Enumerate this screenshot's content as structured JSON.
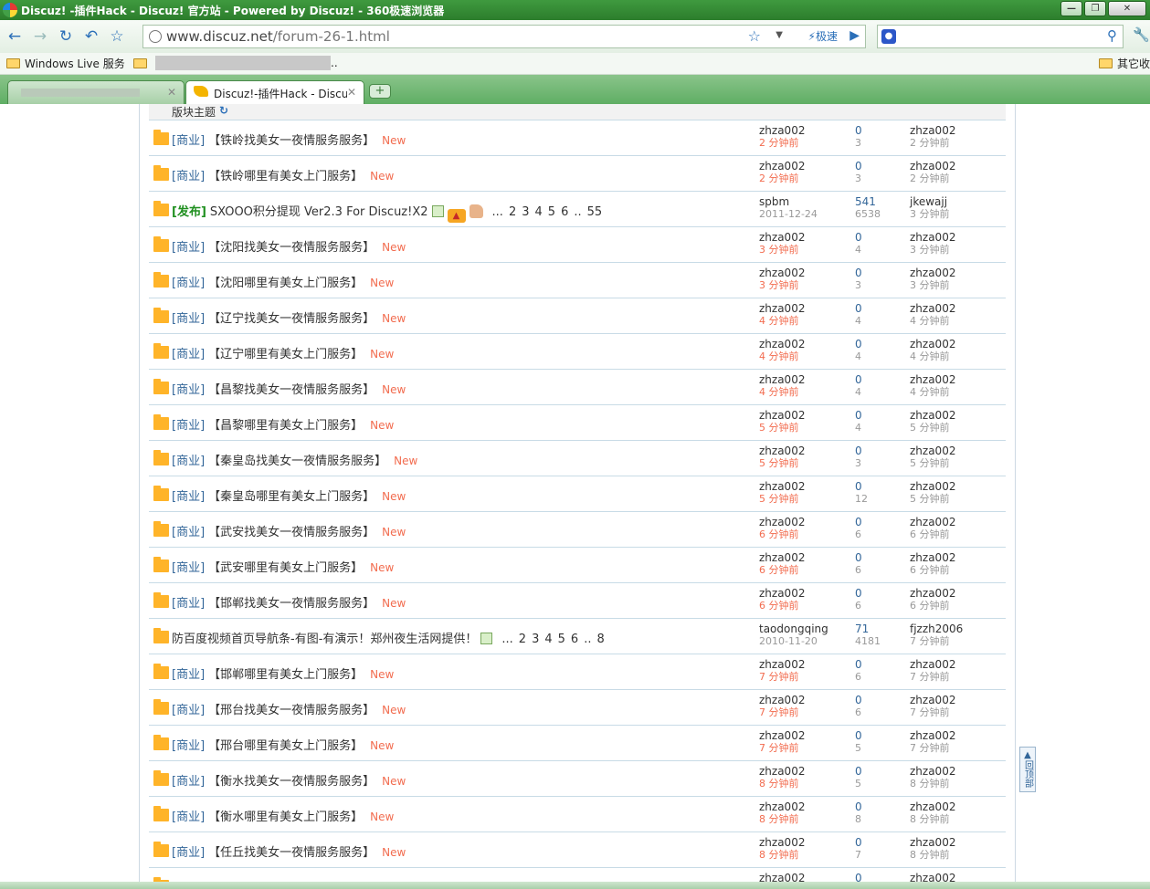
{
  "window": {
    "title": "Discuz! -插件Hack - Discuz! 官方站 - Powered by Discuz! - 360极速浏览器"
  },
  "nav": {
    "url_host": "www.discuz.net",
    "url_path": "/forum-26-1.html",
    "speed_label": "极速"
  },
  "bookmarks": {
    "item1": "Windows Live 服务",
    "item2_suffix": "..",
    "other": "其它收"
  },
  "tabs": {
    "active_title": "Discuz!-插件Hack - Discuz!"
  },
  "forum": {
    "header_label": "版块主题",
    "back_to_top": "回顶部",
    "threads": [
      {
        "cat": "[商业]",
        "title": "【铁岭找美女一夜情服务服务】",
        "new": "New",
        "author": "zhza002",
        "time": "2 分钟前",
        "replies": "0",
        "views": "3",
        "last": "zhza002",
        "last_time": "2 分钟前"
      },
      {
        "cat": "[商业]",
        "title": "【铁岭哪里有美女上门服务】",
        "new": "New",
        "author": "zhza002",
        "time": "2 分钟前",
        "replies": "0",
        "views": "3",
        "last": "zhza002",
        "last_time": "2 分钟前"
      },
      {
        "cat": "[发布]",
        "title": "SXOOO积分提现 Ver2.3 For Discuz!X2",
        "new": "",
        "pages": [
          "...",
          "2",
          "3",
          "4",
          "5",
          "6",
          "..",
          "55"
        ],
        "author": "spbm",
        "time": "2011-12-24",
        "replies": "541",
        "views": "6538",
        "last": "jkewajj",
        "last_time": "3 分钟前"
      },
      {
        "cat": "[商业]",
        "title": "【沈阳找美女一夜情服务服务】",
        "new": "New",
        "author": "zhza002",
        "time": "3 分钟前",
        "replies": "0",
        "views": "4",
        "last": "zhza002",
        "last_time": "3 分钟前"
      },
      {
        "cat": "[商业]",
        "title": "【沈阳哪里有美女上门服务】",
        "new": "New",
        "author": "zhza002",
        "time": "3 分钟前",
        "replies": "0",
        "views": "3",
        "last": "zhza002",
        "last_time": "3 分钟前"
      },
      {
        "cat": "[商业]",
        "title": "【辽宁找美女一夜情服务服务】",
        "new": "New",
        "author": "zhza002",
        "time": "4 分钟前",
        "replies": "0",
        "views": "4",
        "last": "zhza002",
        "last_time": "4 分钟前"
      },
      {
        "cat": "[商业]",
        "title": "【辽宁哪里有美女上门服务】",
        "new": "New",
        "author": "zhza002",
        "time": "4 分钟前",
        "replies": "0",
        "views": "4",
        "last": "zhza002",
        "last_time": "4 分钟前"
      },
      {
        "cat": "[商业]",
        "title": "【昌黎找美女一夜情服务服务】",
        "new": "New",
        "author": "zhza002",
        "time": "4 分钟前",
        "replies": "0",
        "views": "4",
        "last": "zhza002",
        "last_time": "4 分钟前"
      },
      {
        "cat": "[商业]",
        "title": "【昌黎哪里有美女上门服务】",
        "new": "New",
        "author": "zhza002",
        "time": "5 分钟前",
        "replies": "0",
        "views": "4",
        "last": "zhza002",
        "last_time": "5 分钟前"
      },
      {
        "cat": "[商业]",
        "title": "【秦皇岛找美女一夜情服务服务】",
        "new": "New",
        "author": "zhza002",
        "time": "5 分钟前",
        "replies": "0",
        "views": "3",
        "last": "zhza002",
        "last_time": "5 分钟前"
      },
      {
        "cat": "[商业]",
        "title": "【秦皇岛哪里有美女上门服务】",
        "new": "New",
        "author": "zhza002",
        "time": "5 分钟前",
        "replies": "0",
        "views": "12",
        "last": "zhza002",
        "last_time": "5 分钟前"
      },
      {
        "cat": "[商业]",
        "title": "【武安找美女一夜情服务服务】",
        "new": "New",
        "author": "zhza002",
        "time": "6 分钟前",
        "replies": "0",
        "views": "6",
        "last": "zhza002",
        "last_time": "6 分钟前"
      },
      {
        "cat": "[商业]",
        "title": "【武安哪里有美女上门服务】",
        "new": "New",
        "author": "zhza002",
        "time": "6 分钟前",
        "replies": "0",
        "views": "6",
        "last": "zhza002",
        "last_time": "6 分钟前"
      },
      {
        "cat": "[商业]",
        "title": "【邯郸找美女一夜情服务服务】",
        "new": "New",
        "author": "zhza002",
        "time": "6 分钟前",
        "replies": "0",
        "views": "6",
        "last": "zhza002",
        "last_time": "6 分钟前"
      },
      {
        "cat": "",
        "title": "防百度视频首页导航条-有图-有演示！郑州夜生活网提供！",
        "new": "",
        "pages": [
          "...",
          "2",
          "3",
          "4",
          "5",
          "6",
          "..",
          "8"
        ],
        "author": "taodongqing",
        "time": "2010-11-20",
        "replies": "71",
        "views": "4181",
        "last": "fjzzh2006",
        "last_time": "7 分钟前"
      },
      {
        "cat": "[商业]",
        "title": "【邯郸哪里有美女上门服务】",
        "new": "New",
        "author": "zhza002",
        "time": "7 分钟前",
        "replies": "0",
        "views": "6",
        "last": "zhza002",
        "last_time": "7 分钟前"
      },
      {
        "cat": "[商业]",
        "title": "【邢台找美女一夜情服务服务】",
        "new": "New",
        "author": "zhza002",
        "time": "7 分钟前",
        "replies": "0",
        "views": "6",
        "last": "zhza002",
        "last_time": "7 分钟前"
      },
      {
        "cat": "[商业]",
        "title": "【邢台哪里有美女上门服务】",
        "new": "New",
        "author": "zhza002",
        "time": "7 分钟前",
        "replies": "0",
        "views": "5",
        "last": "zhza002",
        "last_time": "7 分钟前"
      },
      {
        "cat": "[商业]",
        "title": "【衡水找美女一夜情服务服务】",
        "new": "New",
        "author": "zhza002",
        "time": "8 分钟前",
        "replies": "0",
        "views": "5",
        "last": "zhza002",
        "last_time": "8 分钟前"
      },
      {
        "cat": "[商业]",
        "title": "【衡水哪里有美女上门服务】",
        "new": "New",
        "author": "zhza002",
        "time": "8 分钟前",
        "replies": "0",
        "views": "8",
        "last": "zhza002",
        "last_time": "8 分钟前"
      },
      {
        "cat": "[商业]",
        "title": "【任丘找美女一夜情服务服务】",
        "new": "New",
        "author": "zhza002",
        "time": "8 分钟前",
        "replies": "0",
        "views": "7",
        "last": "zhza002",
        "last_time": "8 分钟前"
      },
      {
        "cat": "",
        "title": "",
        "new": "",
        "author": "zhza002",
        "time": "",
        "replies": "0",
        "views": "",
        "last": "zhza002",
        "last_time": ""
      }
    ]
  }
}
